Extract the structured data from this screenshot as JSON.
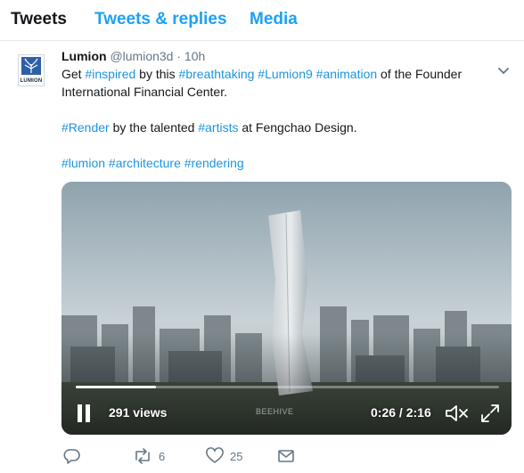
{
  "tabs": [
    {
      "label": "Tweets",
      "active": true
    },
    {
      "label": "Tweets & replies",
      "active": false
    },
    {
      "label": "Media",
      "active": false
    }
  ],
  "tweet": {
    "avatar_text": "LUMION",
    "author_name": "Lumion",
    "author_handle": "@lumion3d",
    "separator": "·",
    "time": "10h",
    "line1": {
      "t1": "Get ",
      "h1": "#inspired",
      "t2": " by this ",
      "h2": "#breathtaking",
      "t3": " ",
      "h3": "#Lumion9",
      "t4": " ",
      "h4": "#animation",
      "t5": " of the Founder"
    },
    "line2": "International Financial Center.",
    "line3": {
      "h1": "#Render",
      "t1": " by the talented ",
      "h2": "#artists",
      "t2": " at Fengchao Design."
    },
    "line4": {
      "h1": "#lumion",
      "t1": " ",
      "h2": "#architecture",
      "t2": " ",
      "h3": "#rendering"
    }
  },
  "video": {
    "views": "291 views",
    "watermark": "BEEHIVE",
    "current_time": "0:26",
    "time_separator": " / ",
    "duration": "2:16",
    "progress_fraction": 0.19
  },
  "actions": {
    "reply_icon": "reply-icon",
    "retweet_count": "6",
    "like_count": "25",
    "dm_icon": "envelope-icon"
  },
  "colors": {
    "accent": "#1da1f2",
    "hashtag": "#1b95e0",
    "muted": "#657786"
  }
}
